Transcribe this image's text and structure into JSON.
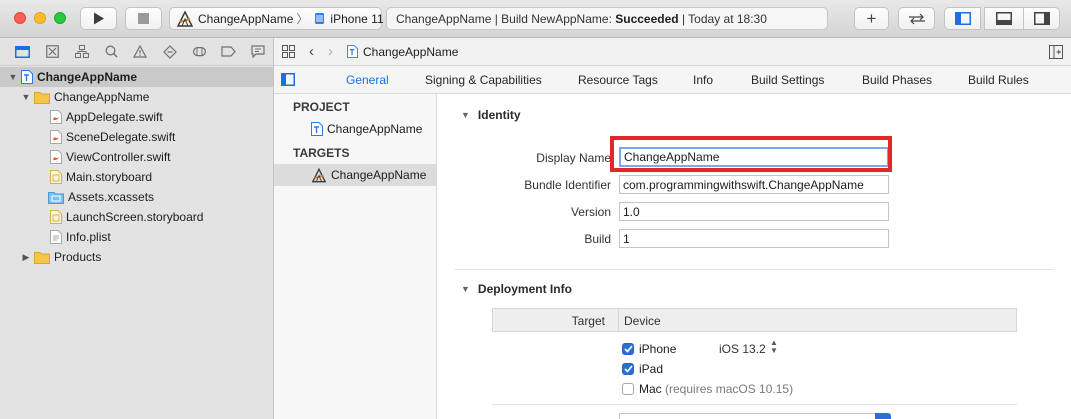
{
  "toolbar": {
    "scheme_target": "ChangeAppName",
    "scheme_device": "iPhone 11",
    "activity_prefix": "ChangeAppName | Build NewAppName: ",
    "activity_status": "Succeeded",
    "activity_suffix": " | Today at 18:30"
  },
  "navigator": {
    "items": [
      {
        "label": "ChangeAppName",
        "icon": "project-file-icon"
      },
      {
        "label": "ChangeAppName",
        "icon": "folder-icon"
      },
      {
        "label": "AppDelegate.swift",
        "icon": "swift-file-icon"
      },
      {
        "label": "SceneDelegate.swift",
        "icon": "swift-file-icon"
      },
      {
        "label": "ViewController.swift",
        "icon": "swift-file-icon"
      },
      {
        "label": "Main.storyboard",
        "icon": "storyboard-file-icon"
      },
      {
        "label": "Assets.xcassets",
        "icon": "asset-catalog-icon"
      },
      {
        "label": "LaunchScreen.storyboard",
        "icon": "storyboard-file-icon"
      },
      {
        "label": "Info.plist",
        "icon": "plist-file-icon"
      },
      {
        "label": "Products",
        "icon": "folder-icon"
      }
    ]
  },
  "editor": {
    "breadcrumb": "ChangeAppName",
    "tabs": [
      "General",
      "Signing & Capabilities",
      "Resource Tags",
      "Info",
      "Build Settings",
      "Build Phases",
      "Build Rules"
    ],
    "project_header": "PROJECT",
    "project_item": "ChangeAppName",
    "targets_header": "TARGETS",
    "target_item": "ChangeAppName"
  },
  "identity": {
    "title": "Identity",
    "display_name_label": "Display Name",
    "display_name_value": "ChangeAppName",
    "bundle_id_label": "Bundle Identifier",
    "bundle_id_value": "com.programmingwithswift.ChangeAppName",
    "version_label": "Version",
    "version_value": "1.0",
    "build_label": "Build",
    "build_value": "1"
  },
  "deployment": {
    "title": "Deployment Info",
    "col_target": "Target",
    "col_device": "Device",
    "ios_version": "iOS 13.2",
    "devices": [
      {
        "label": "iPhone",
        "checked": true,
        "note": ""
      },
      {
        "label": "iPad",
        "checked": true,
        "note": ""
      },
      {
        "label": "Mac",
        "checked": false,
        "note": "(requires macOS 10.15)"
      }
    ]
  },
  "colors": {
    "accent": "#1b6fe5",
    "highlight_box": "#e4252a",
    "checkbox_on": "#2a6fd6"
  }
}
